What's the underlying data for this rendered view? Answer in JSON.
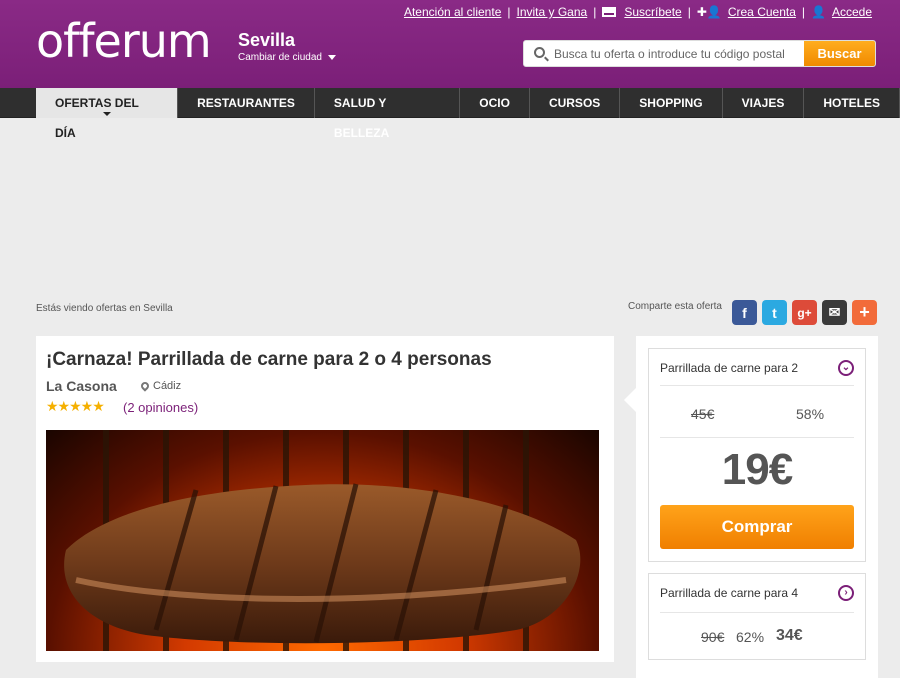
{
  "brand": {
    "logo_text": "offerum",
    "purple": "#7b1f78",
    "orange": "#f08a00"
  },
  "header": {
    "city": "Sevilla",
    "change_city": "Cambiar de ciudad",
    "links": {
      "customer_service": "Atención al cliente",
      "invite": "Invita y Gana",
      "subscribe": "Suscríbete",
      "create_account": "Crea Cuenta",
      "login": "Accede"
    },
    "search": {
      "placeholder": "Busca tu oferta o introduce tu código postal",
      "button": "Buscar"
    }
  },
  "nav": {
    "items": [
      "OFERTAS DEL DÍA",
      "RESTAURANTES",
      "SALUD Y BELLEZA",
      "OCIO",
      "CURSOS",
      "SHOPPING",
      "VIAJES",
      "HOTELES"
    ],
    "active": "OFERTAS DEL DÍA"
  },
  "viewing_text": "Estás viendo ofertas en Sevilla",
  "share": {
    "label": "Comparte esta oferta",
    "buttons": [
      "facebook",
      "twitter",
      "google-plus",
      "email",
      "more"
    ]
  },
  "deal": {
    "title": "¡Carnaza! Parrillada de carne para 2 o 4 personas",
    "merchant": "La Casona",
    "location": "Cádiz",
    "rating_stars": 5,
    "reviews": "(2 opiniones)"
  },
  "options": [
    {
      "title": "Parrillada de carne para 2",
      "original": "45€",
      "discount": "58%",
      "price": "19€",
      "buy": "Comprar"
    },
    {
      "title": "Parrillada de carne para 4",
      "original": "90€",
      "discount": "62%",
      "price": "34€"
    }
  ]
}
